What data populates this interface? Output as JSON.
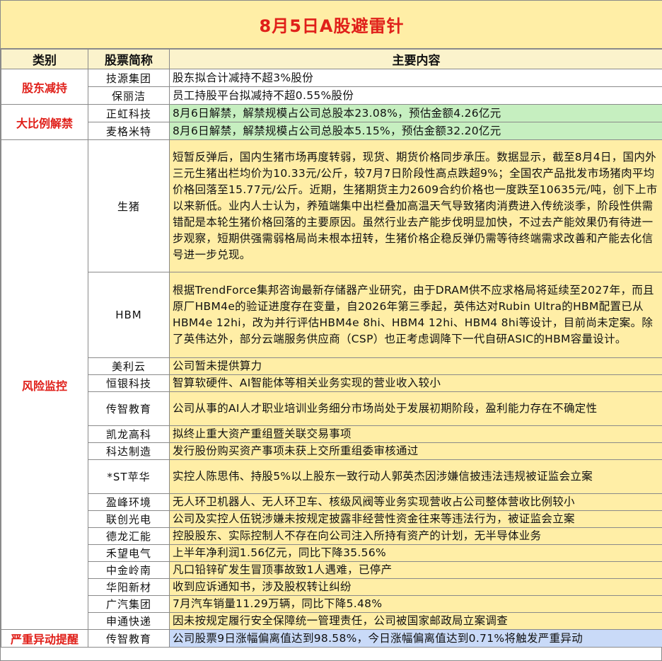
{
  "title": "8月5日A股避雷针",
  "headers": {
    "category": "类别",
    "stock": "股票简称",
    "content": "主要内容"
  },
  "sections": {
    "shareholder_reduction": {
      "label": "股东减持",
      "rows": [
        {
          "stock": "技源集团",
          "content": "股东拟合计减持不超3%股份"
        },
        {
          "stock": "保丽洁",
          "content": "员工持股平台拟减持不超0.55%股份"
        }
      ]
    },
    "lifting": {
      "label": "大比例解禁",
      "rows": [
        {
          "stock": "正虹科技",
          "content": "8月6日解禁，解禁规模占公司总股本23.08%，预估金额4.26亿元"
        },
        {
          "stock": "麦格米特",
          "content": "8月6日解禁，解禁规模占公司总股本5.15%，预估金额32.20亿元"
        }
      ]
    },
    "risk": {
      "label": "风险监控",
      "rows": [
        {
          "stock": "生猪",
          "content": "短暂反弹后，国内生猪市场再度转弱，现货、期货价格同步承压。数据显示，截至8月4日，国内外三元生猪出栏均价为10.33元/公斤，较7月7日阶段性高点跌超9%；全国农产品批发市场猪肉平均价格回落至15.77元/公斤。近期，生猪期货主力2609合约价格也一度跌至10635元/吨，创下上市以来新低。业内人士认为，养殖端集中出栏叠加高温天气导致猪肉消费进入传统淡季，阶段性供需错配是本轮生猪价格回落的主要原因。虽然行业去产能步伐明显加快，不过去产能效果仍有待进一步观察，短期供强需弱格局尚未根本扭转，生猪价格企稳反弹仍需等待终端需求改善和产能去化信号进一步兑现。"
        },
        {
          "stock": "HBM",
          "content": "根据TrendForce集邦咨询最新存储器产业研究，由于DRAM供不应求格局将延续至2027年，而且原厂HBM4e的验证进度存在变量，自2026年第三季起，英伟达对Rubin Ultra的HBM配置已从HBM4e 12hi，改为并行评估HBM4e 8hi、HBM4 12hi、HBM4 8hi等设计，目前尚未定案。除了英伟达外，部分云端服务供应商（CSP）也正考虑调降下一代自研ASIC的HBM容量设计。"
        },
        {
          "stock": "美利云",
          "content": "公司暂未提供算力"
        },
        {
          "stock": "恒银科技",
          "content": "智算软硬件、AI智能体等相关业务实现的营业收入较小"
        },
        {
          "stock": "传智教育",
          "content": "公司从事的AI人才职业培训业务细分市场尚处于发展初期阶段，盈利能力存在不确定性"
        },
        {
          "stock": "凯龙高科",
          "content": "拟终止重大资产重组暨关联交易事项"
        },
        {
          "stock": "科达制造",
          "content": "发行股份购买资产事项未获上交所重组委审核通过"
        },
        {
          "stock": "*ST苹华",
          "content": "实控人陈思伟、持股5%以上股东一致行动人郭英杰因涉嫌信披违法违规被证监会立案"
        },
        {
          "stock": "盈峰环境",
          "content": "无人环卫机器人、无人环卫车、核级风阀等业务实现营收占公司整体营收比例较小"
        },
        {
          "stock": "联创光电",
          "content": "公司及实控人伍锐涉嫌未按规定披露非经营性资金往来等违法行为，被证监会立案"
        },
        {
          "stock": "德龙汇能",
          "content": "控股股东、实际控制人不存在向公司注入所持有资产的计划，无半导体业务"
        },
        {
          "stock": "禾望电气",
          "content": "上半年净利润1.56亿元，同比下降35.56%"
        },
        {
          "stock": "中金岭南",
          "content": "凡口铅锌矿发生冒顶事故致1人遇难，已停产"
        },
        {
          "stock": "华阳新材",
          "content": "收到应诉通知书，涉及股权转让纠纷"
        },
        {
          "stock": "广汽集团",
          "content": "7月汽车销量11.29万辆，同比下降5.48%"
        },
        {
          "stock": "申通快递",
          "content": "因未按规定履行安全保障统一管理责任，公司被国家邮政局立案调查"
        }
      ]
    },
    "abnormal": {
      "label": "严重异动提醒",
      "rows": [
        {
          "stock": "传智教育",
          "content": "公司股票9日涨幅偏离值达到98.58%，今日涨幅偏离值达到0.71%将触发严重异动"
        }
      ]
    }
  },
  "colors": {
    "title_bg": "#ffeea6",
    "title_text": "#e0201a",
    "content_bg": "#ffeea6",
    "lifting_bg": "#c6efc0",
    "abnormal_bg": "#c9daf8",
    "category_text": "#e0201a"
  }
}
